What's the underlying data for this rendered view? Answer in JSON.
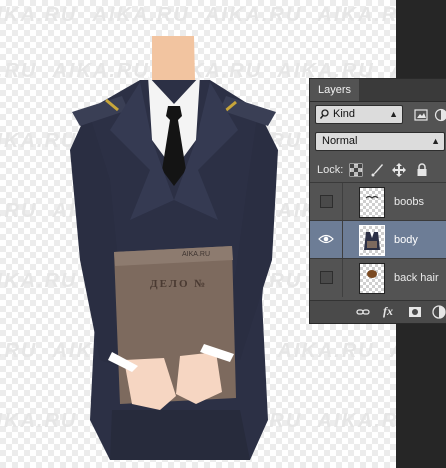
{
  "watermark": {
    "text": "AIKA.RU"
  },
  "folder_label": "ДЕЛО №",
  "folder_corner": "AIKA.RU",
  "layers_panel": {
    "tab_title": "Layers",
    "filter_label": "Kind",
    "blend_mode": "Normal",
    "lock_label": "Lock:",
    "layers": [
      {
        "name": "boobs",
        "visible": false,
        "selected": false
      },
      {
        "name": "body",
        "visible": true,
        "selected": true
      },
      {
        "name": "back hair",
        "visible": false,
        "selected": false
      }
    ],
    "footer_icons": [
      "link-icon",
      "fx-icon",
      "mask-icon",
      "adjustment-icon"
    ],
    "fx_label": "fx"
  }
}
